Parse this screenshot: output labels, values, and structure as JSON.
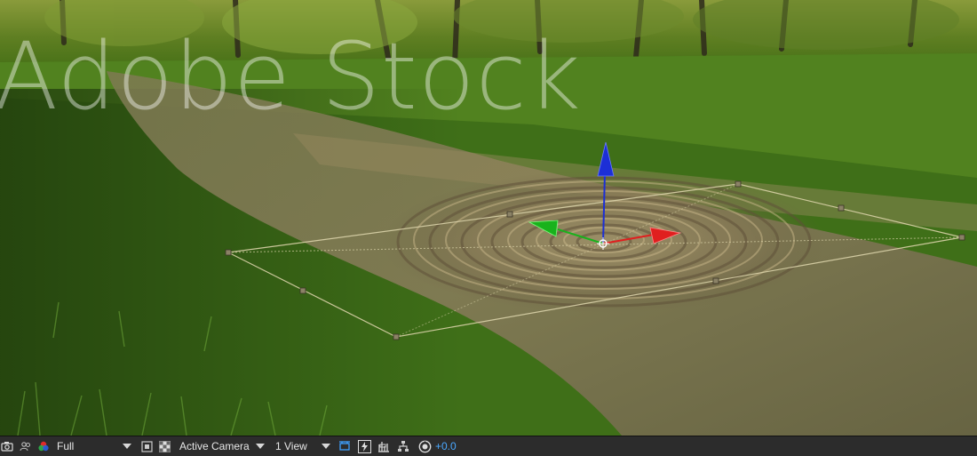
{
  "viewport": {
    "watermark_text": "Adobe Stock",
    "gizmo": {
      "x_axis_color": "#e01f1f",
      "y_axis_color": "#19b21c",
      "z_axis_color": "#1c2fd6"
    },
    "layer_outline_color": "#d9d2a8"
  },
  "toolbar": {
    "snapshot_icon": "camera-icon",
    "show_snapshot_icon": "snapshot-people-icon",
    "channel_icon": "rgb-channels-icon",
    "resolution": {
      "value": "Full"
    },
    "region_of_interest_icon": "region-of-interest-icon",
    "transparency_grid_icon": "transparency-grid-icon",
    "camera_view": {
      "value": "Active Camera"
    },
    "view_layout": {
      "value": "1 View"
    },
    "toggle_pixel_aspect_icon": "pixel-aspect-icon",
    "fast_previews_icon": "fast-previews-icon",
    "timeline_icon": "timeline-icon",
    "flowchart_icon": "flowchart-icon",
    "reset_exposure_icon": "reset-exposure-icon",
    "exposure_value": "+0.0",
    "accent_color": "#4aa8ff"
  }
}
